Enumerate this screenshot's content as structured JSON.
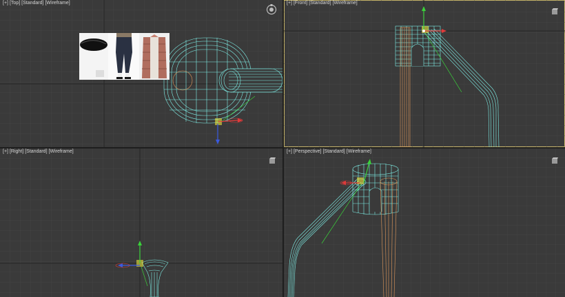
{
  "viewports": [
    {
      "id": "top",
      "labels": [
        "[+]",
        "[Top]",
        "[Standard]",
        "[Wireframe]"
      ]
    },
    {
      "id": "front",
      "labels": [
        "[+]",
        "[Front]",
        "[Standard]",
        "[Wireframe]"
      ]
    },
    {
      "id": "right",
      "labels": [
        "[+]",
        "[Right]",
        "[Standard]",
        "[Wireframe]"
      ]
    },
    {
      "id": "perspective",
      "labels": [
        "[+]",
        "[Perspective]",
        "[Standard]",
        "[Wireframe]"
      ]
    }
  ],
  "colors": {
    "viewport_bg": "#3a3a3a",
    "grid": "#474747",
    "grid_axis": "#262626",
    "wire_cyan": "#7ff0e8",
    "wire_orange": "#e39a5c",
    "active_border": "#c8b66a",
    "gizmo_x": "#e03a3a",
    "gizmo_y": "#3ad13a",
    "gizmo_z": "#3a5ae0",
    "gizmo_plane": "#e8e23a"
  },
  "icons": [
    "viewcube-icon",
    "steering-wheel-icon",
    "transform-gizmo-icon"
  ],
  "reference_image": [
    "hat-photo",
    "trousers-photo",
    "puffer-jacket-photo"
  ]
}
